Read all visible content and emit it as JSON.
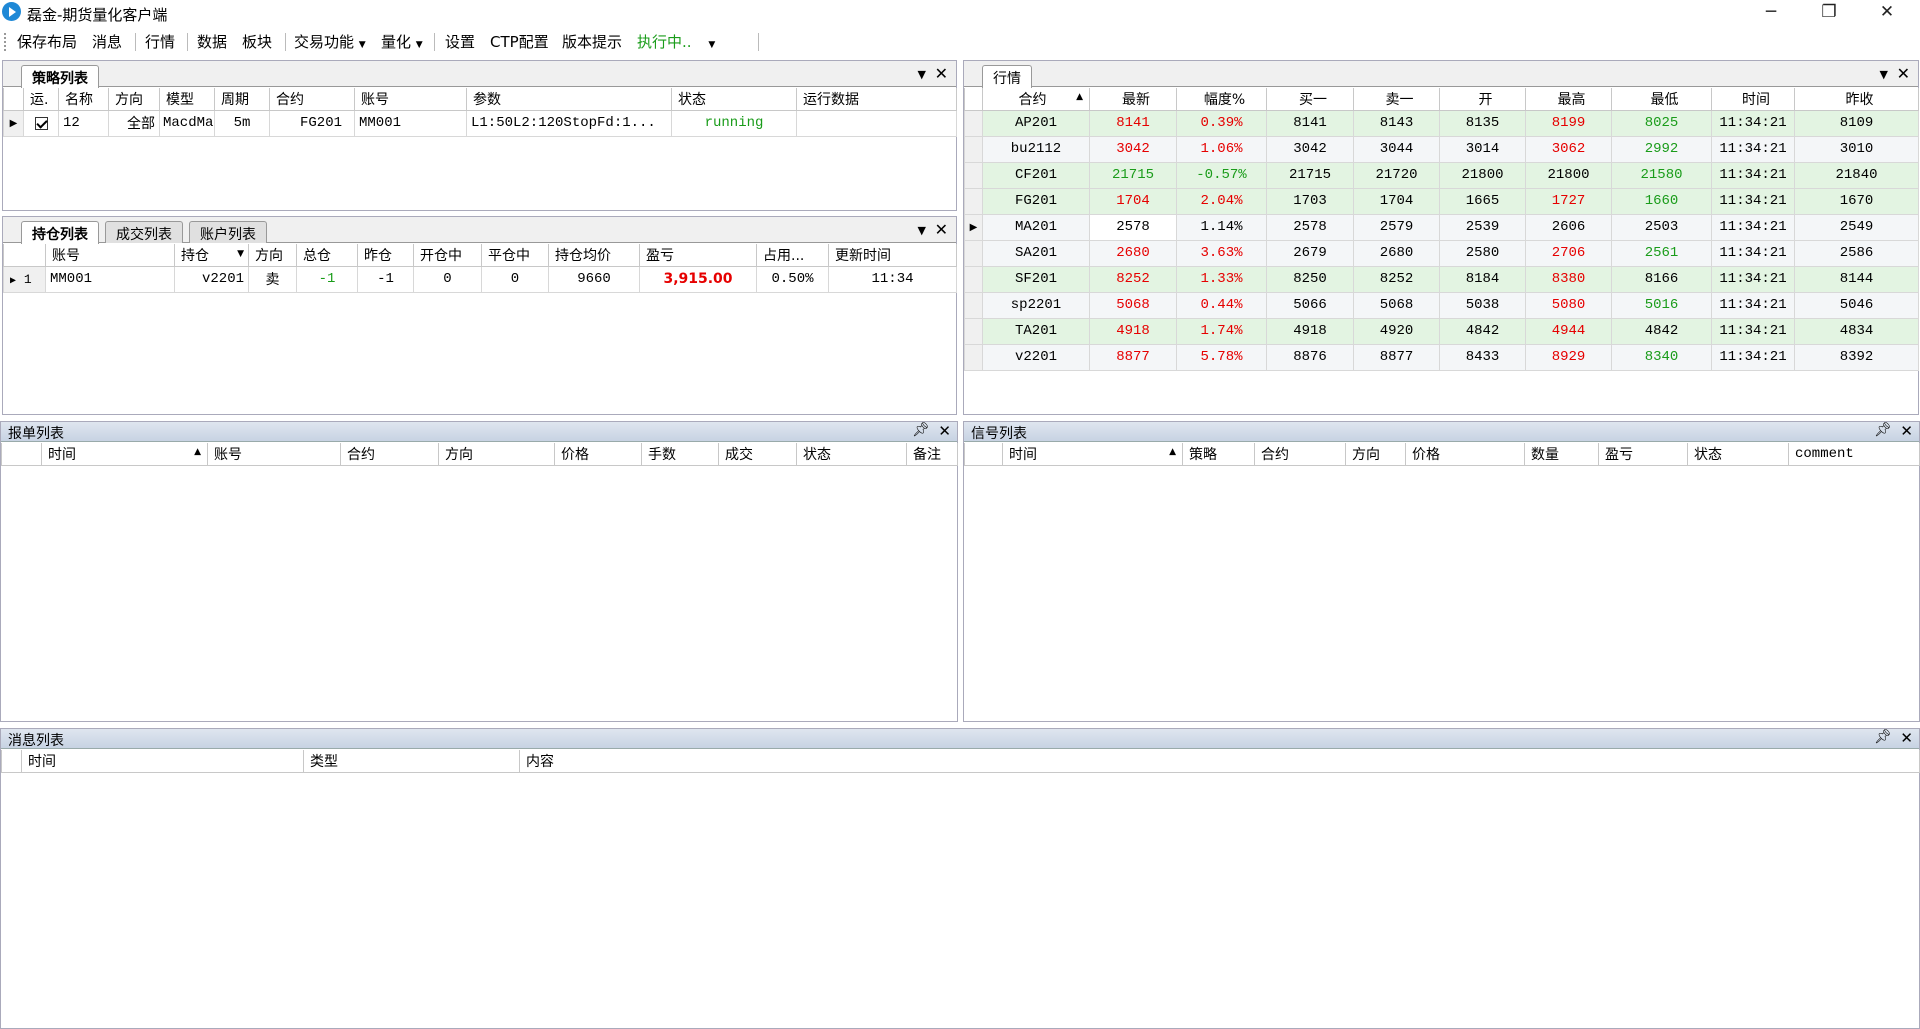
{
  "window": {
    "title": "磊金-期货量化客户端",
    "minimize": "─",
    "maximize": "❐",
    "close": "✕"
  },
  "toolbar": {
    "save_layout": "保存布局",
    "message": "消息",
    "quotes": "行情",
    "data": "数据",
    "sector": "板块",
    "trade": "交易功能",
    "quant": "量化",
    "settings": "设置",
    "ctp": "CTP配置",
    "version": "版本提示",
    "running": "执行中.."
  },
  "strategy": {
    "tab": "策略列表",
    "headers": [
      "运.",
      "名称",
      "方向",
      "模型",
      "周期",
      "合约",
      "账号",
      "参数",
      "状态",
      "运行数据"
    ],
    "row": {
      "name": "12",
      "dir": "全部",
      "model": "MacdMa",
      "period": "5m",
      "contract": "FG201",
      "account": "MM001",
      "params": "L1:50L2:120StopFd:1...",
      "status": "running",
      "run": ""
    }
  },
  "positions": {
    "tabs": [
      "持仓列表",
      "成交列表",
      "账户列表"
    ],
    "headers": [
      "账号",
      "持仓",
      "方向",
      "总仓",
      "昨仓",
      "开仓中",
      "平仓中",
      "持仓均价",
      "盈亏",
      "占用...",
      "更新时间"
    ],
    "row": {
      "idx": "1",
      "account": "MM001",
      "contract": "v2201",
      "dir": "卖",
      "total": "-1",
      "yest": "-1",
      "opening": "0",
      "closing": "0",
      "avg": "9660",
      "pnl": "3,915.00",
      "margin": "0.50%",
      "time": "11:34"
    }
  },
  "quotes": {
    "tab": "行情",
    "headers": [
      "合约",
      "最新",
      "幅度%",
      "买一",
      "卖一",
      "开",
      "最高",
      "最低",
      "时间",
      "昨收"
    ],
    "rows": [
      [
        "AP201",
        "8141",
        "0.39%",
        "8141",
        "8143",
        "8135",
        "8199",
        "8025",
        "11:34:21",
        "8109"
      ],
      [
        "bu2112",
        "3042",
        "1.06%",
        "3042",
        "3044",
        "3014",
        "3062",
        "2992",
        "11:34:21",
        "3010"
      ],
      [
        "CF201",
        "21715",
        "-0.57%",
        "21715",
        "21720",
        "21800",
        "21800",
        "21580",
        "11:34:21",
        "21840"
      ],
      [
        "FG201",
        "1704",
        "2.04%",
        "1703",
        "1704",
        "1665",
        "1727",
        "1660",
        "11:34:21",
        "1670"
      ],
      [
        "MA201",
        "2578",
        "1.14%",
        "2578",
        "2579",
        "2539",
        "2606",
        "2503",
        "11:34:21",
        "2549"
      ],
      [
        "SA201",
        "2680",
        "3.63%",
        "2679",
        "2680",
        "2580",
        "2706",
        "2561",
        "11:34:21",
        "2586"
      ],
      [
        "SF201",
        "8252",
        "1.33%",
        "8250",
        "8252",
        "8184",
        "8380",
        "8166",
        "11:34:21",
        "8144"
      ],
      [
        "sp2201",
        "5068",
        "0.44%",
        "5066",
        "5068",
        "5038",
        "5080",
        "5016",
        "11:34:21",
        "5046"
      ],
      [
        "TA201",
        "4918",
        "1.74%",
        "4918",
        "4920",
        "4842",
        "4944",
        "4842",
        "11:34:21",
        "4834"
      ],
      [
        "v2201",
        "8877",
        "5.78%",
        "8876",
        "8877",
        "8433",
        "8929",
        "8340",
        "11:34:21",
        "8392"
      ]
    ]
  },
  "orders": {
    "title": "报单列表",
    "headers": [
      "时间",
      "账号",
      "合约",
      "方向",
      "价格",
      "手数",
      "成交",
      "状态",
      "备注"
    ]
  },
  "signals": {
    "title": "信号列表",
    "headers": [
      "时间",
      "策略",
      "合约",
      "方向",
      "价格",
      "数量",
      "盈亏",
      "状态",
      "comment"
    ]
  },
  "messages": {
    "title": "消息列表",
    "headers": [
      "时间",
      "类型",
      "内容"
    ]
  },
  "colors": {
    "up": "#e60000",
    "down": "#1a9c1a",
    "running": "#1a9c1a"
  }
}
